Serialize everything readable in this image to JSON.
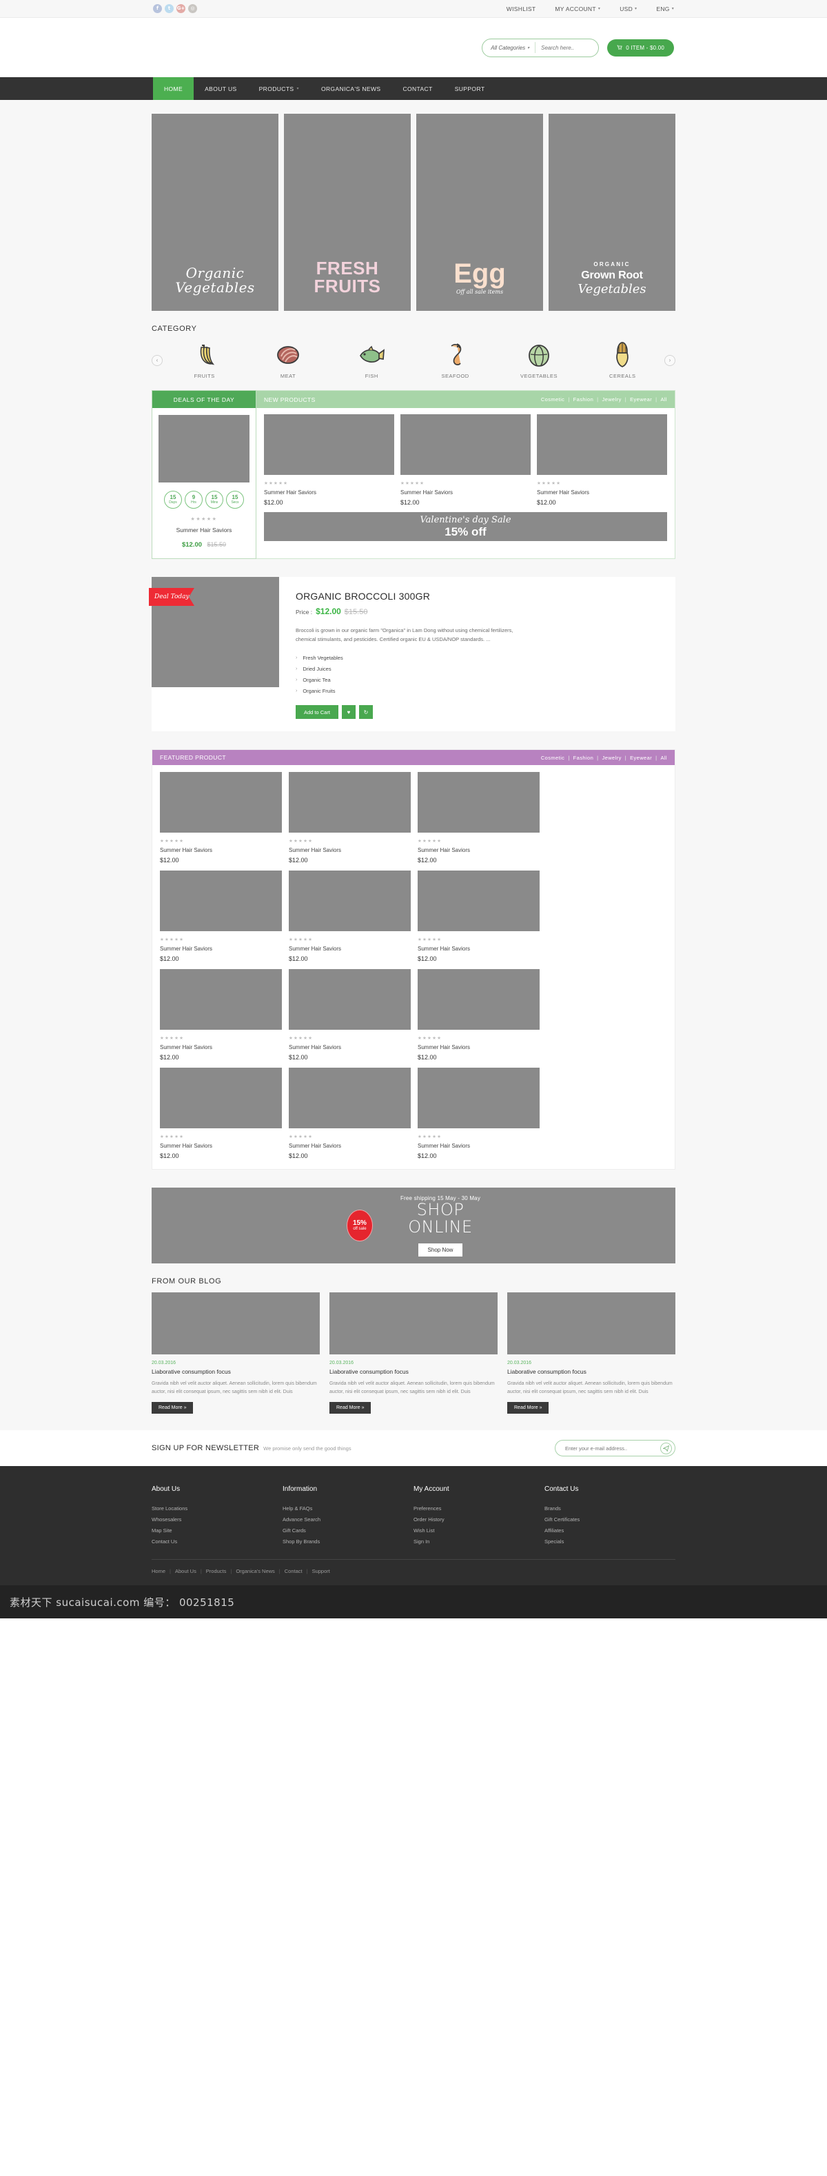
{
  "topbar": {
    "social": [
      {
        "name": "facebook-icon",
        "glyph": "f"
      },
      {
        "name": "twitter-icon",
        "glyph": "t"
      },
      {
        "name": "googleplus-icon",
        "glyph": "G+"
      },
      {
        "name": "instagram-icon",
        "glyph": "◎"
      }
    ],
    "links": [
      {
        "label": "WISHLIST",
        "caret": false
      },
      {
        "label": "MY ACCOUNT",
        "caret": true
      },
      {
        "label": "USD",
        "caret": true
      },
      {
        "label": "ENG",
        "caret": true
      }
    ],
    "caret_glyph": "▾"
  },
  "header": {
    "category_select": "All Categories",
    "search_placeholder": "Search here..",
    "search_icon": "⚲",
    "cart_icon": "≡",
    "cart_label": "0 ITEM - $0.00"
  },
  "mainnav": {
    "items": [
      {
        "label": "HOME",
        "active": true,
        "caret": false
      },
      {
        "label": "ABOUT US",
        "active": false,
        "caret": false
      },
      {
        "label": "PRODUCTS",
        "active": false,
        "caret": true
      },
      {
        "label": "ORGANICA'S NEWS",
        "active": false,
        "caret": false
      },
      {
        "label": "CONTACT",
        "active": false,
        "caret": false
      },
      {
        "label": "SUPPORT",
        "active": false,
        "caret": false
      }
    ],
    "caret_glyph": "▾"
  },
  "hero": {
    "banner1": {
      "line1": "Organic",
      "line2": "Vegetables"
    },
    "banner2": {
      "line1": "FRESH",
      "line2": "FRUITS"
    },
    "banner3": {
      "main": "Egg",
      "sub": "Off all sale items"
    },
    "banner4": {
      "kicker": "ORGANIC",
      "bold": "Grown Root",
      "script": "Vegetables"
    }
  },
  "category": {
    "title": "CATEGORY",
    "prev_glyph": "‹",
    "next_glyph": "›",
    "items": [
      {
        "label": "FRUITS",
        "icon": "banana-icon"
      },
      {
        "label": "MEAT",
        "icon": "steak-icon"
      },
      {
        "label": "FISH",
        "icon": "fish-icon"
      },
      {
        "label": "SEAFOOD",
        "icon": "shrimp-icon"
      },
      {
        "label": "VEGETABLES",
        "icon": "cabbage-icon"
      },
      {
        "label": "CEREALS",
        "icon": "corn-icon"
      }
    ]
  },
  "deals": {
    "title": "DEALS OF THE DAY",
    "countdown": [
      {
        "num": "15",
        "unit": "Days"
      },
      {
        "num": "9",
        "unit": "Hrs"
      },
      {
        "num": "15",
        "unit": "Mins"
      },
      {
        "num": "15",
        "unit": "Secs"
      }
    ],
    "stars": "★★★★★",
    "product_name": "Summer Hair Saviors",
    "price": "$12.00",
    "old_price": "$15.50"
  },
  "new_products": {
    "title": "NEW PRODUCTS",
    "filters": [
      "Cosmetic",
      "Fashion",
      "Jewelry",
      "Eyewear",
      "All"
    ],
    "separator": "|",
    "cards": [
      {
        "stars": "★★★★★",
        "name": "Summer Hair Saviors",
        "price": "$12.00"
      },
      {
        "stars": "★★★★★",
        "name": "Summer Hair Saviors",
        "price": "$12.00"
      },
      {
        "stars": "★★★★★",
        "name": "Summer Hair Saviors",
        "price": "$12.00"
      }
    ],
    "promo": {
      "line1": "Valentine's day Sale",
      "line2": "15% off"
    }
  },
  "deal_today": {
    "ribbon": "Deal Today",
    "title": "ORGANIC BROCCOLI 300GR",
    "price_label": "Price :",
    "price": "$12.00",
    "old_price": "$15.50",
    "description": "Broccoli is grown in our organic farm \"Organica\" in Lam Dong without using chemical fertilizers, chemical stimulants, and pesticides. Certified organic EU & USDA/NOP standards. ...",
    "features": [
      "Fresh Vegetables",
      "Dried Juices",
      "Organic Tea",
      "Organic Fruits"
    ],
    "chevron": "›",
    "add_to_cart": "Add to Cart",
    "wishlist_icon": "♥",
    "compare_icon": "↻"
  },
  "featured": {
    "title": "FEATURED PRODUCT",
    "filters": [
      "Cosmetic",
      "Fashion",
      "Jewelry",
      "Eyewear",
      "All"
    ],
    "separator": "|",
    "cards": [
      {
        "stars": "★★★★★",
        "name": "Summer Hair Saviors",
        "price": "$12.00"
      },
      {
        "stars": "★★★★★",
        "name": "Summer Hair Saviors",
        "price": "$12.00"
      },
      {
        "stars": "★★★★★",
        "name": "Summer Hair Saviors",
        "price": "$12.00"
      },
      {
        "stars": "★★★★★",
        "name": "Summer Hair Saviors",
        "price": "$12.00"
      },
      {
        "stars": "★★★★★",
        "name": "Summer Hair Saviors",
        "price": "$12.00"
      },
      {
        "stars": "★★★★★",
        "name": "Summer Hair Saviors",
        "price": "$12.00"
      },
      {
        "stars": "★★★★★",
        "name": "Summer Hair Saviors",
        "price": "$12.00"
      },
      {
        "stars": "★★★★★",
        "name": "Summer Hair Saviors",
        "price": "$12.00"
      },
      {
        "stars": "★★★★★",
        "name": "Summer Hair Saviors",
        "price": "$12.00"
      },
      {
        "stars": "★★★★★",
        "name": "Summer Hair Saviors",
        "price": "$12.00"
      },
      {
        "stars": "★★★★★",
        "name": "Summer Hair Saviors",
        "price": "$12.00"
      },
      {
        "stars": "★★★★★",
        "name": "Summer Hair Saviors",
        "price": "$12.00"
      }
    ]
  },
  "shop_banner": {
    "badge_pct": "15%",
    "badge_sub": "off sale",
    "shipping": "Free shipping 15 May - 30 May",
    "line1": "SHOP",
    "line2": "ONLINE",
    "button": "Shop Now"
  },
  "blog": {
    "title": "FROM OUR BLOG",
    "posts": [
      {
        "date": "20.03.2016",
        "title": "Liaborative consumption focus",
        "excerpt": "Gravida nibh vel velit auctor aliquet. Aenean sollicitudin, lorem quis bibendum auctor, nisi elit consequat ipsum, nec sagittis sem nibh id elit. Duis",
        "button": "Read More »"
      },
      {
        "date": "20.03.2016",
        "title": "Liaborative consumption focus",
        "excerpt": "Gravida nibh vel velit auctor aliquet. Aenean sollicitudin, lorem quis bibendum auctor, nisi elit consequat ipsum, nec sagittis sem nibh id elit. Duis",
        "button": "Read More »"
      },
      {
        "date": "20.03.2016",
        "title": "Liaborative consumption focus",
        "excerpt": "Gravida nibh vel velit auctor aliquet. Aenean sollicitudin, lorem quis bibendum auctor, nisi elit consequat ipsum, nec sagittis sem nibh id elit. Duis",
        "button": "Read More »"
      }
    ]
  },
  "newsletter": {
    "title": "SIGN UP FOR NEWSLETTER",
    "subtitle": "We promise only send the good things",
    "placeholder": "Enter your e-mail address..",
    "send_icon": "➤"
  },
  "footer": {
    "columns": [
      {
        "heading": "About Us",
        "links": [
          "Store Locations",
          "Whosesalers",
          "Map Site",
          "Contact Us"
        ]
      },
      {
        "heading": "Information",
        "links": [
          "Help & FAQs",
          "Advance Search",
          "Gift Cards",
          "Shop By Brands"
        ]
      },
      {
        "heading": "My Account",
        "links": [
          "Preferences",
          "Order History",
          "Wish List",
          "Sign In"
        ]
      },
      {
        "heading": "Contact Us",
        "links": [
          "Brands",
          "Gift Certificates",
          "Affiliates",
          "Specials"
        ]
      }
    ],
    "bottom_nav": [
      "Home",
      "About Us",
      "Products",
      "Organica's News",
      "Contact",
      "Support"
    ],
    "separator": "|"
  },
  "watermark": {
    "text": "素材天下 sucaisucai.com  编号： 00251815"
  },
  "colors": {
    "green": "#47a84d",
    "dark_nav": "#333333",
    "purple": "#b882c0",
    "red": "#e5252e",
    "placeholder_gray": "#8a8a8a"
  }
}
